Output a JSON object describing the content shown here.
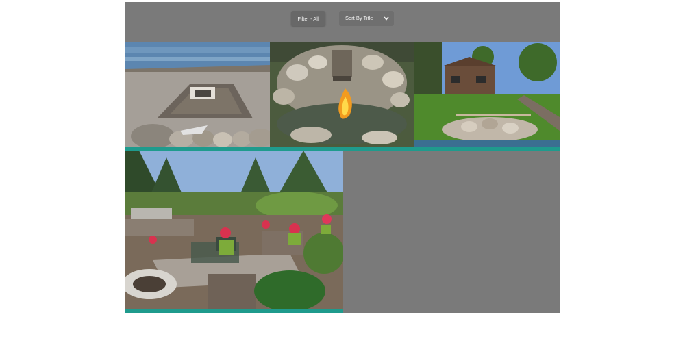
{
  "toolbar": {
    "filter_label": "Filter - All",
    "sort_label": "Sort By Title"
  },
  "icons": {
    "sort_toggle": "chevron-down-icon"
  },
  "colors": {
    "panel_bg": "#7a7a7a",
    "tile_accent": "#1f9b8d"
  }
}
